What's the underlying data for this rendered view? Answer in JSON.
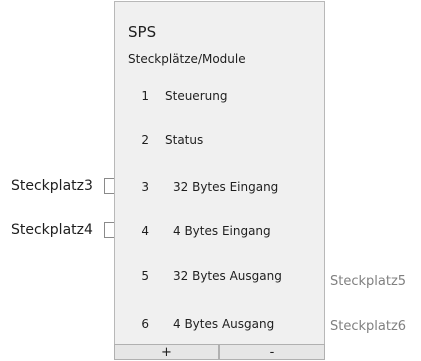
{
  "panel": {
    "title": "SPS",
    "subtitle": "Steckplätze/Module",
    "slots": [
      {
        "number": "1",
        "label": "Steuerung"
      },
      {
        "number": "2",
        "label": "Status"
      },
      {
        "number": "3",
        "label": "32 Bytes Eingang"
      },
      {
        "number": "4",
        "label": "4 Bytes Eingang"
      },
      {
        "number": "5",
        "label": "32 Bytes Ausgang"
      },
      {
        "number": "6",
        "label": "4 Bytes Ausgang"
      }
    ],
    "add_label": "+",
    "remove_label": "-"
  },
  "left_slots": [
    {
      "label": "Steckplatz3",
      "checked": false
    },
    {
      "label": "Steckplatz4",
      "checked": false
    }
  ],
  "right_slots": [
    {
      "label": "Steckplatz5"
    },
    {
      "label": "Steckplatz6"
    }
  ]
}
